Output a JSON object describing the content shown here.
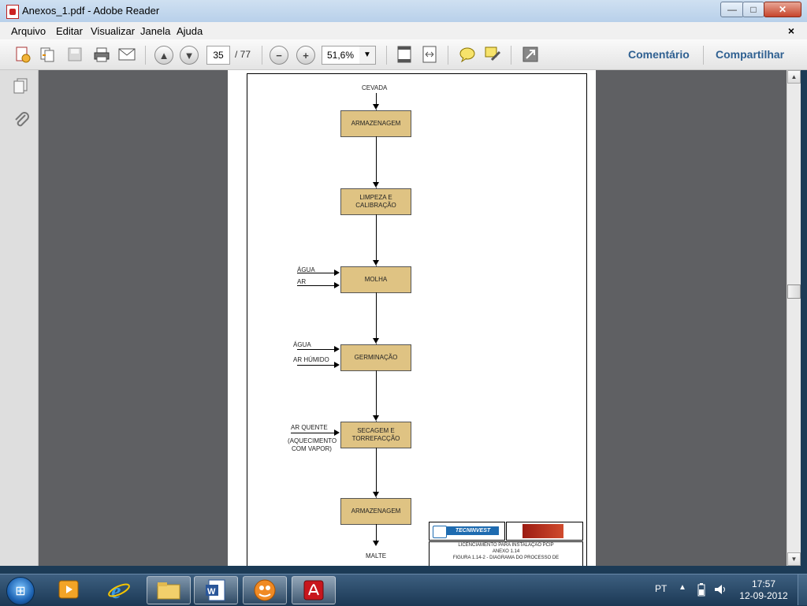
{
  "window": {
    "title": "Anexos_1.pdf - Adobe Reader",
    "minimize": "—",
    "maximize": "□",
    "close": "✕"
  },
  "menu": {
    "items": [
      "Arquivo",
      "Editar",
      "Visualizar",
      "Janela",
      "Ajuda"
    ],
    "close": "×"
  },
  "toolbar": {
    "page_current": "35",
    "page_total": "/ 77",
    "zoom": "51,6%",
    "comment": "Comentário",
    "share": "Compartilhar",
    "icons": [
      "create-pdf-icon",
      "combine-icon",
      "save-icon",
      "print-icon",
      "email-icon",
      "page-up-icon",
      "page-down-icon",
      "zoom-out-icon",
      "zoom-in-icon",
      "fit-page-icon",
      "fit-width-icon",
      "comment-icon",
      "highlight-icon",
      "fullscreen-icon"
    ]
  },
  "diagram": {
    "input_top": "CEVADA",
    "output_bottom": "MALTE",
    "steps": [
      {
        "label": "ARMAZENAGEM"
      },
      {
        "label": "LIMPEZA E CALIBRAÇÃO"
      },
      {
        "label": "MOLHA"
      },
      {
        "label": "GERMINAÇÃO"
      },
      {
        "label": "SECAGEM E TORREFACÇÃO"
      },
      {
        "label": "ARMAZENAGEM"
      }
    ],
    "inputs": {
      "molha_1": "ÁGUA",
      "molha_2": "AR",
      "germ_1": "ÁGUA",
      "germ_2": "AR HÚMIDO",
      "sec_1": "AR QUENTE",
      "sec_2": "(AQUECIMENTO",
      "sec_3": "COM VAPOR)"
    },
    "logo_text": "TECNINVEST",
    "footer_1": "LICENCIAMENTO PARA INSTALAÇÃO PCIP",
    "footer_2": "ANEXO 1.14",
    "footer_3": "FIGURA 1.14-2 - DIAGRAMA DO PROCESSO DE"
  },
  "taskbar": {
    "lang": "PT",
    "time": "17:57",
    "date": "12-09-2012",
    "apps": [
      "media-player-icon",
      "internet-explorer-icon",
      "file-explorer-icon",
      "word-icon",
      "messenger-icon",
      "adobe-reader-icon"
    ]
  },
  "colors": {
    "process_box": "#dfc383",
    "document_bg": "#5f6063",
    "link": "#2f6091"
  }
}
